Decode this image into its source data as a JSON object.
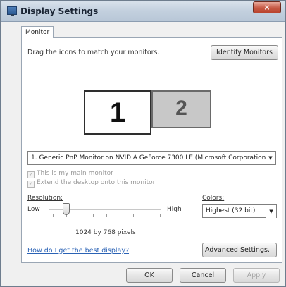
{
  "window": {
    "title": "Display Settings",
    "close_label": "×"
  },
  "tabs": [
    {
      "label": "Monitor"
    }
  ],
  "monitor_tab": {
    "instruction": "Drag the icons to match your monitors.",
    "identify_button": "Identify Monitors",
    "monitors": [
      {
        "number": "1"
      },
      {
        "number": "2"
      }
    ],
    "monitor_dropdown": {
      "selected": "1. Generic PnP Monitor on NVIDIA GeForce 7300 LE (Microsoft Corporation",
      "arrow": "▼"
    },
    "main_monitor_checkbox": {
      "label": "This is my main monitor",
      "checked": true,
      "enabled": false
    },
    "extend_desktop_checkbox": {
      "label": "Extend the desktop onto this monitor",
      "checked": true,
      "enabled": false
    },
    "resolution": {
      "label": "Resolution:",
      "low_label": "Low",
      "high_label": "High",
      "value": "1024 by 768 pixels"
    },
    "colors": {
      "label": "Colors:",
      "selected": "Highest (32 bit)",
      "arrow": "▼"
    },
    "help_link": "How do I get the best display?",
    "advanced_button": "Advanced Settings..."
  },
  "footer": {
    "ok_button": "OK",
    "cancel_button": "Cancel",
    "apply_button": "Apply"
  }
}
